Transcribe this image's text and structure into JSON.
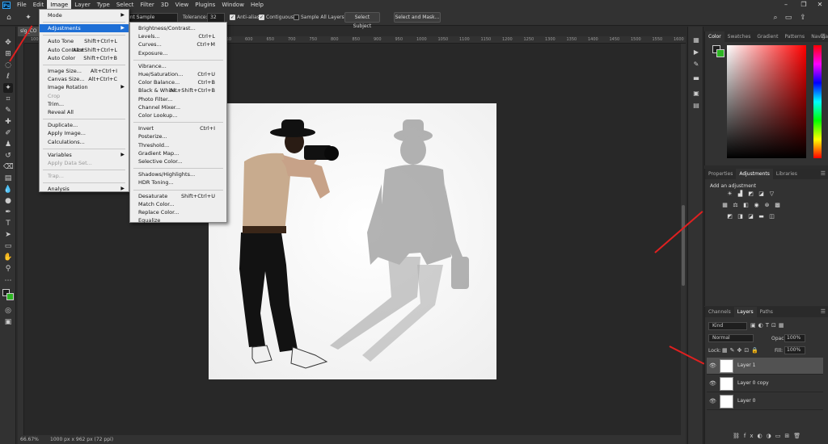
{
  "app_logo": "Ps",
  "menubar": {
    "items": [
      "File",
      "Edit",
      "Image",
      "Layer",
      "Type",
      "Select",
      "Filter",
      "3D",
      "View",
      "Plugins",
      "Window",
      "Help"
    ],
    "active": "Image"
  },
  "window_controls": {
    "minimize": "–",
    "maximize": "❐",
    "close": "✕"
  },
  "options": {
    "sample_size": "Point Sample",
    "tolerance_label": "Tolerance:",
    "tolerance_value": "32",
    "anti_alias": "Anti-alias",
    "contiguous": "Contiguous",
    "sample_all_layers": "Sample All Layers",
    "select_subject": "Select Subject",
    "select_and_mask": "Select and Mask..."
  },
  "document": {
    "tab": "slg_CO",
    "zoom": "66.67%",
    "info": "1000 px x 962 px (72 ppi)"
  },
  "ruler": [
    "100",
    "150",
    "200",
    "250",
    "300",
    "350",
    "400",
    "450",
    "500",
    "550",
    "600",
    "650",
    "700",
    "750",
    "800",
    "850",
    "900",
    "950",
    "1000",
    "1050",
    "1100",
    "1150",
    "1200",
    "1250",
    "1300",
    "1350",
    "1400",
    "1450",
    "1500",
    "1550",
    "1600"
  ],
  "image_menu": [
    {
      "label": "Mode",
      "arrow": true
    },
    {
      "sep": true
    },
    {
      "label": "Adjustments",
      "arrow": true,
      "hi": true
    },
    {
      "sep": true
    },
    {
      "label": "Auto Tone",
      "sc": "Shift+Ctrl+L"
    },
    {
      "label": "Auto Contrast",
      "sc": "Alt+Shift+Ctrl+L"
    },
    {
      "label": "Auto Color",
      "sc": "Shift+Ctrl+B"
    },
    {
      "sep": true
    },
    {
      "label": "Image Size...",
      "sc": "Alt+Ctrl+I"
    },
    {
      "label": "Canvas Size...",
      "sc": "Alt+Ctrl+C"
    },
    {
      "label": "Image Rotation",
      "arrow": true
    },
    {
      "label": "Crop",
      "dis": true
    },
    {
      "label": "Trim..."
    },
    {
      "label": "Reveal All"
    },
    {
      "sep": true
    },
    {
      "label": "Duplicate..."
    },
    {
      "label": "Apply Image..."
    },
    {
      "label": "Calculations..."
    },
    {
      "sep": true
    },
    {
      "label": "Variables",
      "arrow": true
    },
    {
      "label": "Apply Data Set...",
      "dis": true
    },
    {
      "sep": true
    },
    {
      "label": "Trap...",
      "dis": true
    },
    {
      "sep": true
    },
    {
      "label": "Analysis",
      "arrow": true
    }
  ],
  "adjustments_menu": [
    {
      "label": "Brightness/Contrast..."
    },
    {
      "label": "Levels...",
      "sc": "Ctrl+L"
    },
    {
      "label": "Curves...",
      "sc": "Ctrl+M"
    },
    {
      "label": "Exposure..."
    },
    {
      "sep": true
    },
    {
      "label": "Vibrance..."
    },
    {
      "label": "Hue/Saturation...",
      "sc": "Ctrl+U"
    },
    {
      "label": "Color Balance...",
      "sc": "Ctrl+B"
    },
    {
      "label": "Black & White...",
      "sc": "Alt+Shift+Ctrl+B"
    },
    {
      "label": "Photo Filter..."
    },
    {
      "label": "Channel Mixer..."
    },
    {
      "label": "Color Lookup..."
    },
    {
      "sep": true
    },
    {
      "label": "Invert",
      "sc": "Ctrl+I"
    },
    {
      "label": "Posterize..."
    },
    {
      "label": "Threshold..."
    },
    {
      "label": "Gradient Map..."
    },
    {
      "label": "Selective Color..."
    },
    {
      "sep": true
    },
    {
      "label": "Shadows/Highlights..."
    },
    {
      "label": "HDR Toning..."
    },
    {
      "sep": true
    },
    {
      "label": "Desaturate",
      "sc": "Shift+Ctrl+U"
    },
    {
      "label": "Match Color..."
    },
    {
      "label": "Replace Color..."
    },
    {
      "label": "Equalize"
    }
  ],
  "color_panel": {
    "tabs": [
      "Color",
      "Swatches",
      "Gradient",
      "Patterns",
      "Navigato"
    ]
  },
  "adjust_panel": {
    "tabs": [
      "Properties",
      "Adjustments",
      "Libraries"
    ],
    "heading": "Add an adjustment"
  },
  "layers_panel": {
    "tabs": [
      "Channels",
      "Layers",
      "Paths"
    ],
    "kind": "Kind",
    "blend": "Normal",
    "opacity_label": "Opacity:",
    "opacity": "100%",
    "lock_label": "Lock:",
    "fill_label": "Fill:",
    "fill": "100%",
    "layers": [
      {
        "name": "Layer 1",
        "selected": true
      },
      {
        "name": "Layer 0 copy",
        "selected": false
      },
      {
        "name": "Layer 0",
        "selected": false
      }
    ]
  },
  "colors": {
    "accent": "#1e6fd6",
    "arrow": "#e02020",
    "foreground": "#1f1f1f",
    "background": "#2db523"
  }
}
